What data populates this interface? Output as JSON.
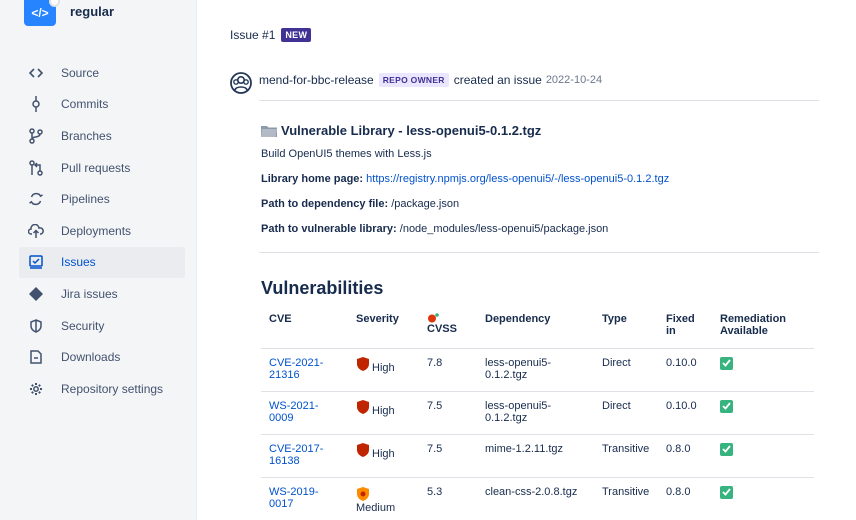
{
  "repo": {
    "name": "regular",
    "avatar_glyph": "</>"
  },
  "sidebar": {
    "items": [
      {
        "label": "Source",
        "icon": "code-icon"
      },
      {
        "label": "Commits",
        "icon": "commit-icon"
      },
      {
        "label": "Branches",
        "icon": "branch-icon"
      },
      {
        "label": "Pull requests",
        "icon": "pull-request-icon"
      },
      {
        "label": "Pipelines",
        "icon": "pipelines-icon"
      },
      {
        "label": "Deployments",
        "icon": "cloud-upload-icon"
      },
      {
        "label": "Issues",
        "icon": "issues-icon",
        "active": true
      },
      {
        "label": "Jira issues",
        "icon": "jira-icon"
      },
      {
        "label": "Security",
        "icon": "shield-icon"
      },
      {
        "label": "Downloads",
        "icon": "file-download-icon"
      },
      {
        "label": "Repository settings",
        "icon": "gear-icon"
      }
    ]
  },
  "issue": {
    "id_label": "Issue #1",
    "badge": "NEW",
    "author": "mend-for-bbc-release",
    "author_badge": "REPO OWNER",
    "action": "created an issue",
    "date": "2022-10-24"
  },
  "library": {
    "title": "Vulnerable Library - less-openui5-0.1.2.tgz",
    "description": "Build OpenUI5 themes with Less.js",
    "home_label": "Library home page:",
    "home_url": "https://registry.npmjs.org/less-openui5/-/less-openui5-0.1.2.tgz",
    "dep_file_label": "Path to dependency file:",
    "dep_file": "/package.json",
    "vuln_lib_label": "Path to vulnerable library:",
    "vuln_lib": "/node_modules/less-openui5/package.json"
  },
  "vulnerabilities": {
    "title": "Vulnerabilities",
    "headers": {
      "cve": "CVE",
      "severity": "Severity",
      "cvss": "CVSS",
      "dependency": "Dependency",
      "type": "Type",
      "fixed": "Fixed in",
      "remediation": "Remediation Available"
    },
    "rows": [
      {
        "cve": "CVE-2021-21316",
        "severity": "High",
        "cvss": "7.8",
        "dependency": "less-openui5-0.1.2.tgz",
        "type": "Direct",
        "fixed": "0.10.0",
        "remediation": "yes"
      },
      {
        "cve": "WS-2021-0009",
        "severity": "High",
        "cvss": "7.5",
        "dependency": "less-openui5-0.1.2.tgz",
        "type": "Direct",
        "fixed": "0.10.0",
        "remediation": "yes"
      },
      {
        "cve": "CVE-2017-16138",
        "severity": "High",
        "cvss": "7.5",
        "dependency": "mime-1.2.11.tgz",
        "type": "Transitive",
        "fixed": "0.8.0",
        "remediation": "yes"
      },
      {
        "cve": "WS-2019-0017",
        "severity": "Medium",
        "cvss": "5.3",
        "dependency": "clean-css-2.0.8.tgz",
        "type": "Transitive",
        "fixed": "0.8.0",
        "remediation": "yes"
      }
    ]
  },
  "colors": {
    "link": "#0052CC",
    "high": "#BF2600",
    "medium": "#FF8B00",
    "check": "#36B37E",
    "badge_new": "#403294"
  }
}
